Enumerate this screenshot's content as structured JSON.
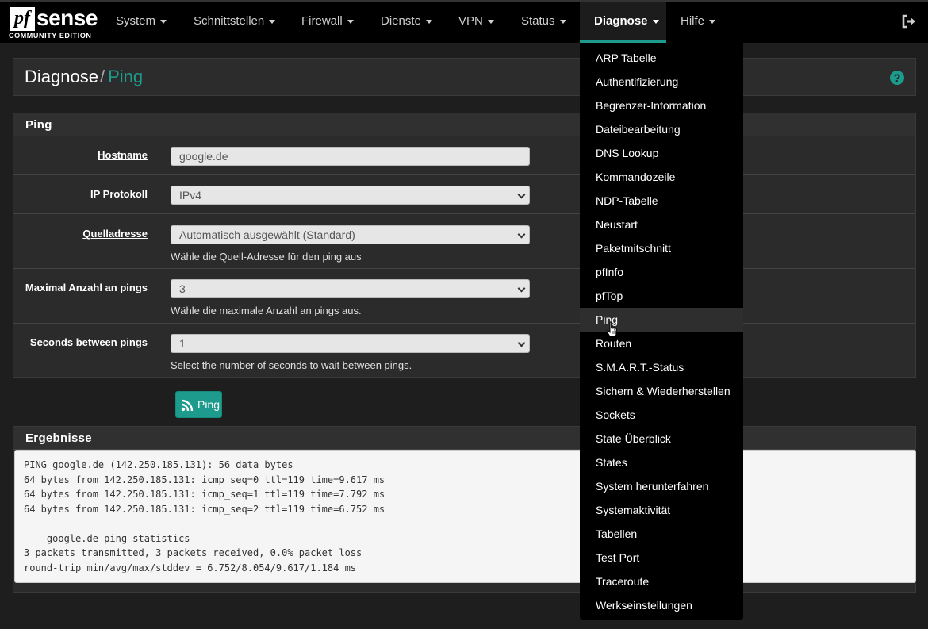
{
  "brand": {
    "logo_pf": "pf",
    "logo_sense": "sense",
    "edition": "COMMUNITY EDITION"
  },
  "nav": {
    "items": [
      {
        "label": "System"
      },
      {
        "label": "Schnittstellen"
      },
      {
        "label": "Firewall"
      },
      {
        "label": "Dienste"
      },
      {
        "label": "VPN"
      },
      {
        "label": "Status"
      },
      {
        "label": "Diagnose"
      },
      {
        "label": "Hilfe"
      }
    ],
    "active": "Diagnose"
  },
  "breadcrumb": {
    "parent": "Diagnose",
    "separator": "/",
    "current": "Ping"
  },
  "ping_panel": {
    "title": "Ping",
    "hostname": {
      "label": "Hostname",
      "value": "google.de"
    },
    "ip_protocol": {
      "label": "IP Protokoll",
      "value": "IPv4"
    },
    "source": {
      "label": "Quelladresse",
      "value": "Automatisch ausgewählt (Standard)",
      "help": "Wähle die Quell-Adresse für den ping aus"
    },
    "max_count": {
      "label": "Maximal Anzahl an pings",
      "value": "3",
      "help": "Wähle die maximale Anzahl an pings aus."
    },
    "interval": {
      "label": "Seconds between pings",
      "value": "1",
      "help": "Select the number of seconds to wait between pings."
    },
    "button_label": "Ping"
  },
  "results": {
    "title": "Ergebnisse",
    "lines": [
      "PING google.de (142.250.185.131): 56 data bytes",
      "64 bytes from 142.250.185.131: icmp_seq=0 ttl=119 time=9.617 ms",
      "64 bytes from 142.250.185.131: icmp_seq=1 ttl=119 time=7.792 ms",
      "64 bytes from 142.250.185.131: icmp_seq=2 ttl=119 time=6.752 ms",
      "",
      "--- google.de ping statistics ---",
      "3 packets transmitted, 3 packets received, 0.0% packet loss",
      "round-trip min/avg/max/stddev = 6.752/8.054/9.617/1.184 ms"
    ]
  },
  "dropdown": {
    "items": [
      {
        "label": "ARP Tabelle"
      },
      {
        "label": "Authentifizierung"
      },
      {
        "label": "Begrenzer-Information"
      },
      {
        "label": "Dateibearbeitung"
      },
      {
        "label": "DNS Lookup"
      },
      {
        "label": "Kommandozeile"
      },
      {
        "label": "NDP-Tabelle"
      },
      {
        "label": "Neustart"
      },
      {
        "label": "Paketmitschnitt"
      },
      {
        "label": "pfInfo"
      },
      {
        "label": "pfTop"
      },
      {
        "label": "Ping"
      },
      {
        "label": "Routen"
      },
      {
        "label": "S.M.A.R.T.-Status"
      },
      {
        "label": "Sichern & Wiederherstellen"
      },
      {
        "label": "Sockets"
      },
      {
        "label": "State Überblick"
      },
      {
        "label": "States"
      },
      {
        "label": "System herunterfahren"
      },
      {
        "label": "Systemaktivität"
      },
      {
        "label": "Tabellen"
      },
      {
        "label": "Test Port"
      },
      {
        "label": "Traceroute"
      },
      {
        "label": "Werkseinstellungen"
      }
    ],
    "hovered": "Ping"
  },
  "colors": {
    "accent": "#1d9b8c",
    "navbar": "#000000",
    "background": "#1e1e1e"
  },
  "icons": {
    "logout": "sign-out-icon",
    "help": "question-circle-icon",
    "ping": "rss-icon",
    "cursor": "hand-pointer-icon"
  }
}
